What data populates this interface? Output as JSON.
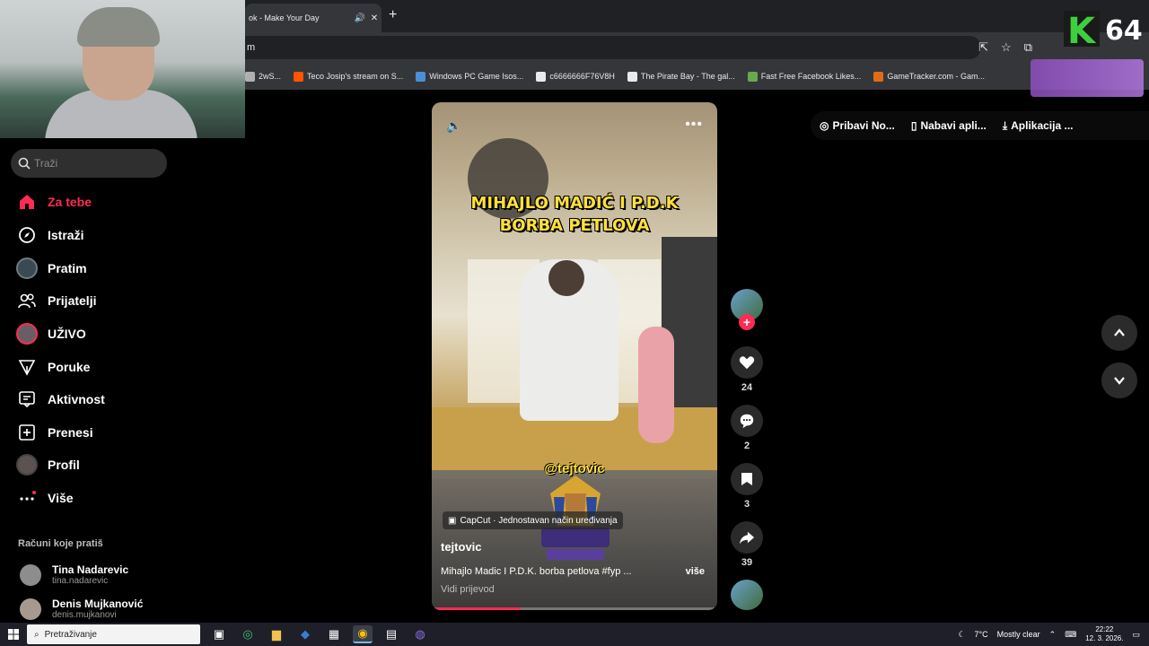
{
  "browser": {
    "tab_title": "ok - Make Your Day",
    "url_fragment": "m",
    "bookmarks": [
      {
        "label": "2wS...",
        "color": "#b0b0b0"
      },
      {
        "label": "Teco Josip's stream on S...",
        "color": "#ff5500"
      },
      {
        "label": "Windows PC Game Isos...",
        "color": "#4a90d9"
      },
      {
        "label": "c6666666F76V8H",
        "color": "#e8eaed"
      },
      {
        "label": "The Pirate Bay - The gal...",
        "color": "#e8eaed"
      },
      {
        "label": "Fast Free Facebook Likes...",
        "color": "#6aa84f"
      },
      {
        "label": "GameTracker.com - Gam...",
        "color": "#e06c1a"
      }
    ]
  },
  "overlay": {
    "logo_letter": "K",
    "logo_number": "64"
  },
  "sidebar": {
    "search_placeholder": "Traži",
    "nav": [
      {
        "label": "Za tebe",
        "icon": "home-icon",
        "active": true
      },
      {
        "label": "Istraži",
        "icon": "compass-icon"
      },
      {
        "label": "Pratim",
        "icon": "following-avatar-icon"
      },
      {
        "label": "Prijatelji",
        "icon": "friends-icon"
      },
      {
        "label": "UŽIVO",
        "icon": "live-avatar-icon"
      },
      {
        "label": "Poruke",
        "icon": "send-icon"
      },
      {
        "label": "Aktivnost",
        "icon": "activity-icon"
      },
      {
        "label": "Prenesi",
        "icon": "upload-icon"
      },
      {
        "label": "Profil",
        "icon": "profile-avatar-icon"
      },
      {
        "label": "Više",
        "icon": "more-dots-icon"
      }
    ],
    "following_title": "Računi koje pratiš",
    "accounts": [
      {
        "name": "Tina Nadarevic",
        "username": "tina.nadarevic"
      },
      {
        "name": "Denis Mujkanović",
        "username": "denis.mujkanovi"
      }
    ]
  },
  "video": {
    "overlay_title_line1": "MIHAJLO MADIĆ I P.D.K",
    "overlay_title_line2": "BORBA PETLOVA",
    "handle_overlay": "@tejtovic",
    "capcut_label": "CapCut · Jednostavan način uređivanja",
    "author": "tejtovic",
    "caption": "Mihajlo Madic I P.D.K. borba petlova #fyp ...",
    "see_more": "više",
    "translate": "Vidi prijevod",
    "progress": 0.31
  },
  "actions": {
    "follow": "+",
    "likes": "24",
    "comments": "2",
    "saves": "3",
    "shares": "39"
  },
  "top_pills": [
    {
      "label": "Pribavi No...",
      "icon": "coin-icon"
    },
    {
      "label": "Nabavi apli...",
      "icon": "phone-icon"
    },
    {
      "label": "Aplikacija ...",
      "icon": "download-icon"
    }
  ],
  "taskbar": {
    "search_placeholder": "Pretraživanje",
    "weather_temp": "7°C",
    "weather_desc": "Mostly clear",
    "time": "22:22",
    "date": "12. 3. 2026."
  },
  "colors": {
    "accent": "#fe2c55",
    "overlay_text": "#ffe13a"
  }
}
